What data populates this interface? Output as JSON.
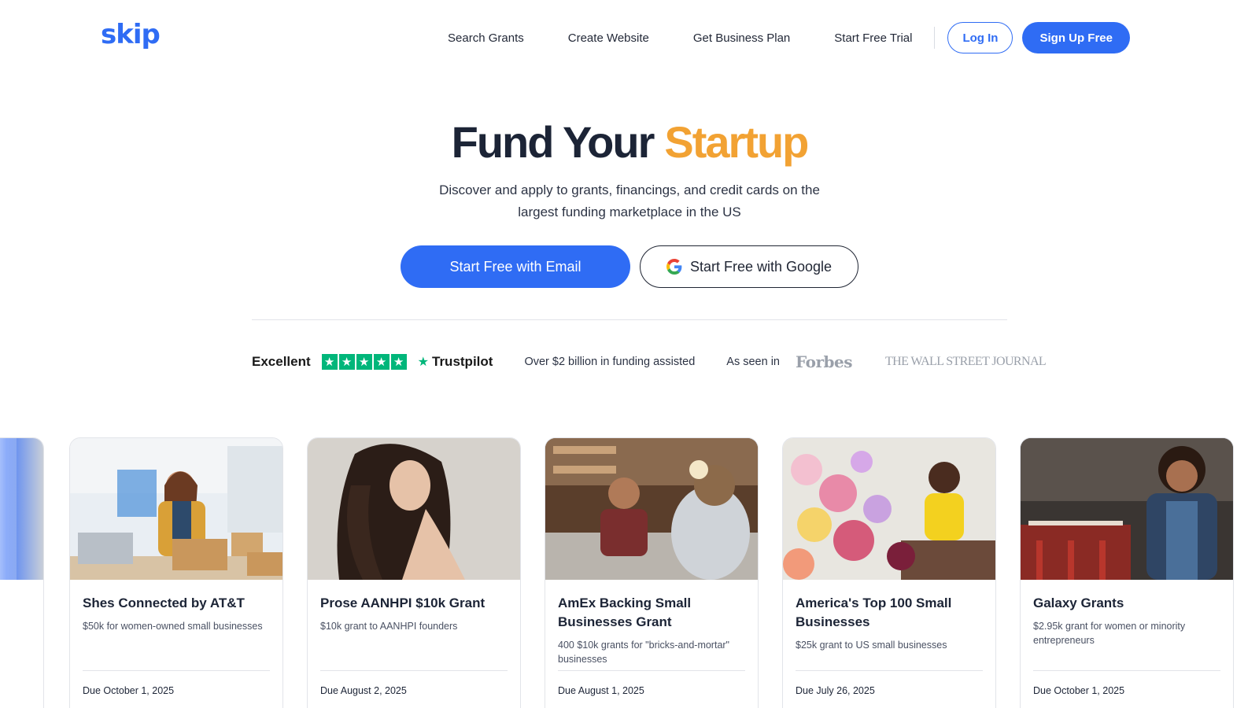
{
  "header": {
    "logo": "skip",
    "nav": [
      "Search Grants",
      "Create Website",
      "Get Business Plan",
      "Start Free Trial"
    ],
    "login": "Log In",
    "signup": "Sign Up Free"
  },
  "hero": {
    "title_main": "Fund Your",
    "title_accent": "Startup",
    "subtitle": "Discover and apply to grants, financings, and credit cards on the largest funding marketplace in the US",
    "cta_email": "Start Free with Email",
    "cta_google": "Start Free with Google"
  },
  "trust": {
    "rating_word": "Excellent",
    "trustpilot": "Trustpilot",
    "funding": "Over $2 billion in funding assisted",
    "as_seen": "As seen in",
    "logo_forbes": "Forbes",
    "logo_wsj": "THE WALL STREET JOURNAL"
  },
  "cards": [
    {
      "title": "Shes Connected by AT&T",
      "desc": "$50k for women-owned small businesses",
      "due_prefix": "Due",
      "due_date": "October 1, 2025",
      "image": "woman-on-phone-with-boxes"
    },
    {
      "title": "Prose AANHPI $10k Grant",
      "desc": "$10k grant to AANHPI founders",
      "due_prefix": "Due",
      "due_date": "August 2, 2025",
      "image": "woman-with-long-hair"
    },
    {
      "title": "AmEx Backing Small Businesses Grant",
      "desc": "400 $10k grants for \"bricks-and-mortar\" businesses",
      "due_prefix": "Due",
      "due_date": "August 1, 2025",
      "image": "barista-at-counter"
    },
    {
      "title": "America's Top 100 Small Businesses",
      "desc": "$25k grant to US small businesses",
      "due_prefix": "Due",
      "due_date": "July 26, 2025",
      "image": "florist-with-flowers"
    },
    {
      "title": "Galaxy Grants",
      "desc": "$2.95k grant for women or minority entrepreneurs",
      "due_prefix": "Due",
      "due_date": "October 1, 2025",
      "image": "restaurant-owner"
    }
  ],
  "colors": {
    "brand_blue": "#2f6cf4",
    "accent_orange": "#f2a233",
    "trustpilot_green": "#00b67a"
  }
}
